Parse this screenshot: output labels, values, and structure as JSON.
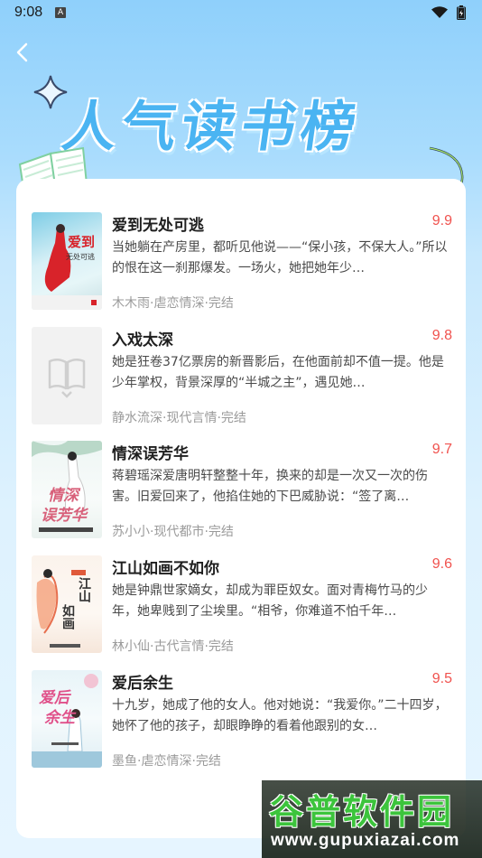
{
  "status_bar": {
    "time": "9:08",
    "notif_glyph": "A"
  },
  "header": {
    "title": "人气读书榜",
    "back_icon": "chevron-left-icon"
  },
  "books": [
    {
      "title": "爱到无处可逃",
      "score": "9.9",
      "desc": "当她躺在产房里，都听见他说——“保小孩，不保大人。”所以的恨在这一刹那爆发。一场火，她把她年少…",
      "meta": "木木雨·虐恋情深·完结",
      "cover_text": "爱到",
      "cover_sub": "无处可逃"
    },
    {
      "title": "入戏太深",
      "score": "9.8",
      "desc": "她是狂卷37亿票房的新晋影后，在他面前却不值一提。他是少年掌权，背景深厚的“半城之主”，遇见她…",
      "meta": "静水流深·现代言情·完结",
      "cover_text": "",
      "cover_sub": ""
    },
    {
      "title": "情深误芳华",
      "score": "9.7",
      "desc": "蒋碧瑶深爱唐明轩整整十年，换来的却是一次又一次的伤害。旧爱回来了，他掐住她的下巴威胁说：“签了离…",
      "meta": "苏小小·现代都市·完结",
      "cover_text": "情深",
      "cover_sub": "误芳华"
    },
    {
      "title": "江山如画不如你",
      "score": "9.6",
      "desc": "她是钟鼎世家嫡女，却成为罪臣奴女。面对青梅竹马的少年，她卑贱到了尘埃里。“相爷，你难道不怕千年…",
      "meta": "林小仙·古代言情·完结",
      "cover_text": "江山",
      "cover_sub": "如画"
    },
    {
      "title": "爱后余生",
      "score": "9.5",
      "desc": "十九岁，她成了他的女人。他对她说：“我爱你。”二十四岁，她怀了他的孩子，却眼睁睁的看着他跟别的女…",
      "meta": "墨鱼·虐恋情深·完结",
      "cover_text": "爱后",
      "cover_sub": "余生"
    }
  ],
  "watermark": {
    "name": "谷普软件园",
    "url": "www.gupuxiazai.com"
  },
  "colors": {
    "score": "#f0524e",
    "title_blue": "#4ab4f2",
    "watermark_green": "#3cc43c"
  }
}
